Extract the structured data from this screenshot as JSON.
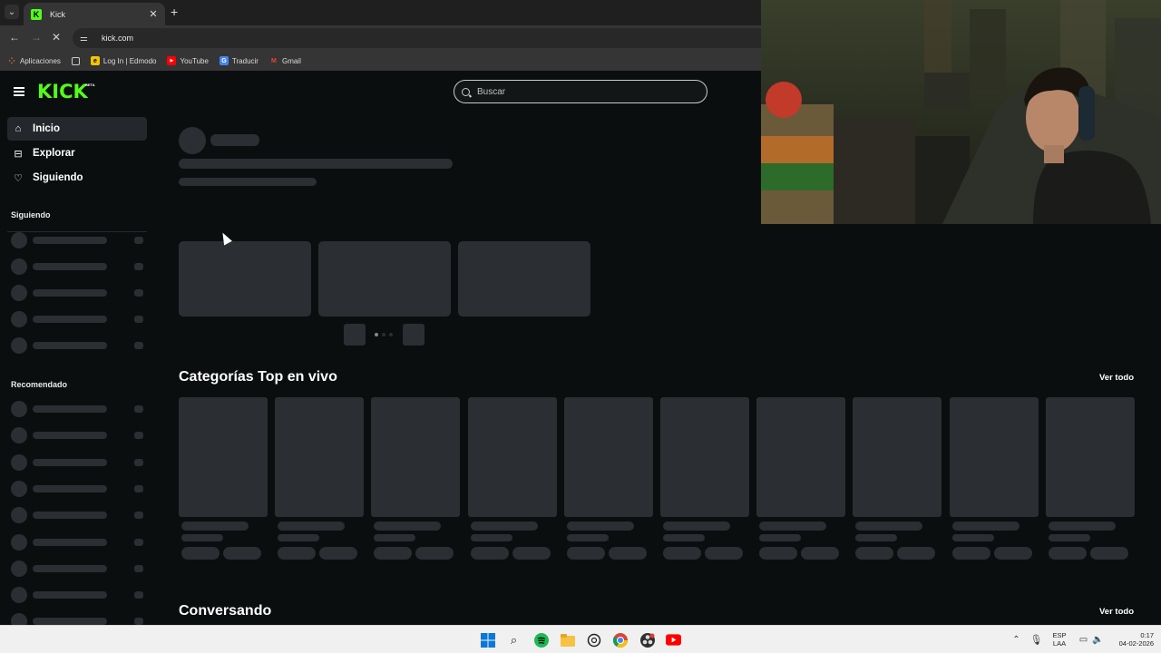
{
  "browser": {
    "tab_title": "Kick",
    "tab_favicon": "K",
    "new_tab": "+",
    "url": "kick.com",
    "bookmarks": [
      {
        "label": "Aplicaciones",
        "icon": "apps-grid-icon"
      },
      {
        "label": "",
        "icon": "grid-icon"
      },
      {
        "label": "Log In | Edmodo",
        "icon": "edmodo-icon"
      },
      {
        "label": "YouTube",
        "icon": "youtube-icon"
      },
      {
        "label": "Traducir",
        "icon": "translate-icon"
      },
      {
        "label": "Gmail",
        "icon": "gmail-icon"
      }
    ]
  },
  "site": {
    "logo": "KICK",
    "logo_badge": "BETA",
    "brand_color": "#53fc18",
    "search_placeholder": "Buscar"
  },
  "sidebar": {
    "items": [
      {
        "label": "Inicio",
        "icon": "home-icon",
        "active": true
      },
      {
        "label": "Explorar",
        "icon": "compass-icon",
        "active": false
      },
      {
        "label": "Siguiendo",
        "icon": "heart-icon",
        "active": false
      }
    ],
    "following_heading": "Siguiendo",
    "recommended_heading": "Recomendado"
  },
  "main": {
    "top_categories_title": "Categorías Top en vivo",
    "top_categories_see_all": "Ver todo",
    "conversing_title": "Conversando",
    "conversing_see_all": "Ver todo"
  },
  "taskbar": {
    "lang_top": "ESP",
    "lang_bottom": "LAA",
    "time": "0:17",
    "date": "04-02-2026"
  }
}
